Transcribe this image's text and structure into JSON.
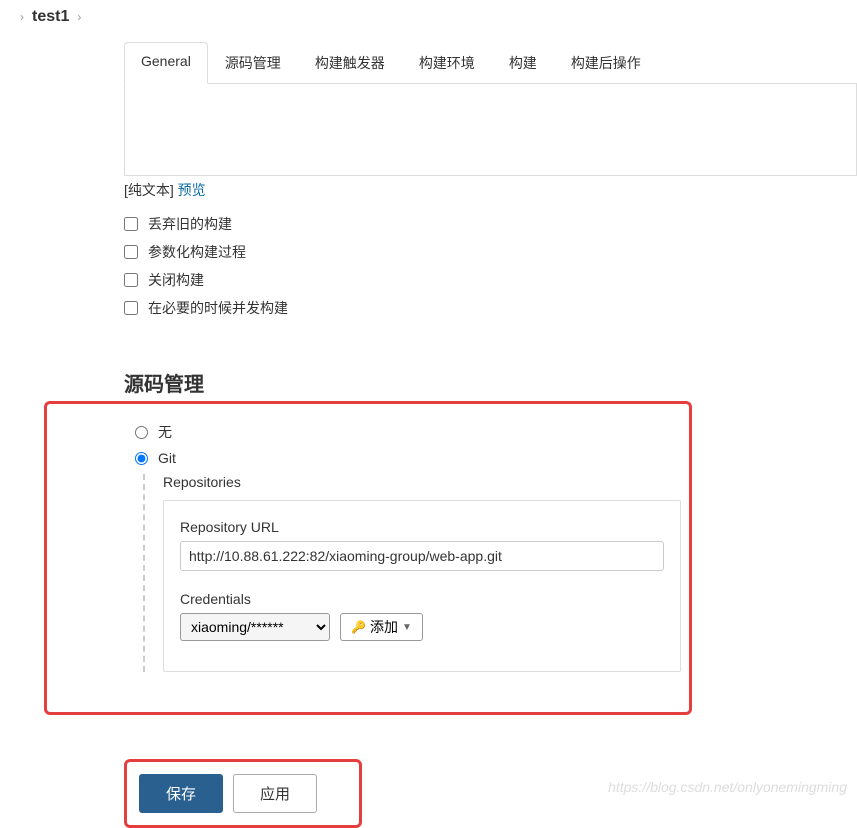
{
  "breadcrumb": {
    "item": "test1"
  },
  "tabs": [
    {
      "label": "General",
      "active": true
    },
    {
      "label": "源码管理",
      "active": false
    },
    {
      "label": "构建触发器",
      "active": false
    },
    {
      "label": "构建环境",
      "active": false
    },
    {
      "label": "构建",
      "active": false
    },
    {
      "label": "构建后操作",
      "active": false
    }
  ],
  "hint": {
    "plain": "[纯文本]",
    "preview": "预览"
  },
  "checkboxes": [
    {
      "label": "丢弃旧的构建"
    },
    {
      "label": "参数化构建过程"
    },
    {
      "label": "关闭构建"
    },
    {
      "label": "在必要的时候并发构建"
    }
  ],
  "scm": {
    "title": "源码管理",
    "none": "无",
    "git": "Git",
    "repos_label": "Repositories",
    "repo_url_label": "Repository URL",
    "repo_url": "http://10.88.61.222:82/xiaoming-group/web-app.git",
    "cred_label": "Credentials",
    "cred_value": "xiaoming/******",
    "add_label": "添加"
  },
  "footer": {
    "save": "保存",
    "apply": "应用"
  },
  "watermark": "https://blog.csdn.net/onlyonemingming"
}
